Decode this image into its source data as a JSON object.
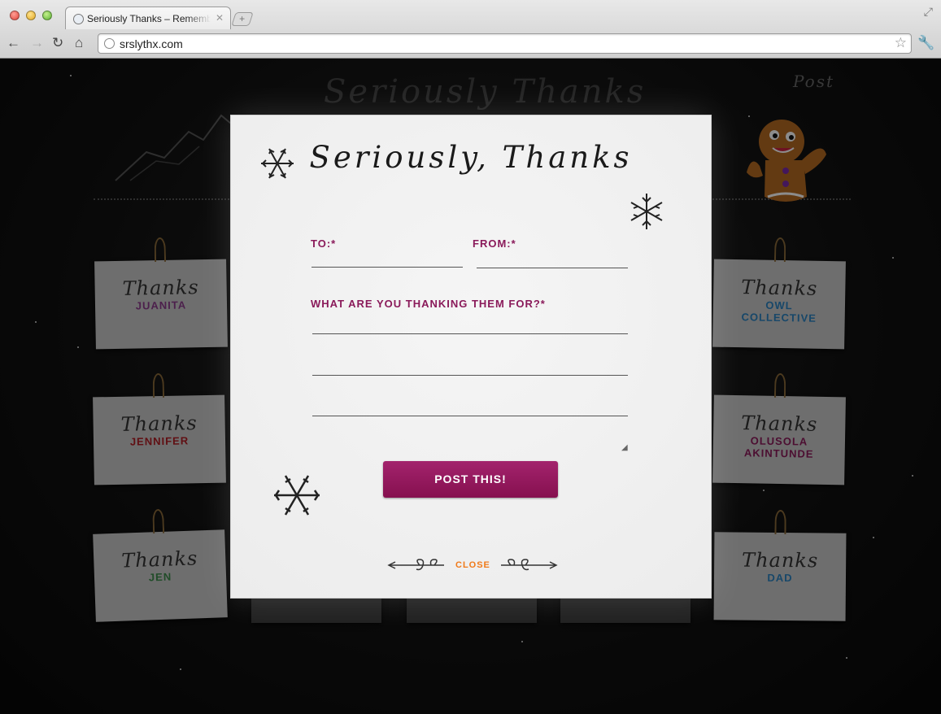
{
  "browser": {
    "tab_title": "Seriously Thanks – Remember",
    "tab_close": "✕",
    "new_tab": "+",
    "url": "srslythx.com"
  },
  "background": {
    "title": "Seriously Thanks",
    "post_label": "Post",
    "cards_left": [
      {
        "word": "Thanks",
        "name": "JUANITA",
        "name_color": "#8a3b8a"
      },
      {
        "word": "Thanks",
        "name": "JENNIFER",
        "name_color": "#b01c24"
      },
      {
        "word": "Thanks",
        "name": "JEN",
        "name_color": "#3b8a4a"
      }
    ],
    "cards_right": [
      {
        "word": "Thanks",
        "name": "OWL COLLECTIVE",
        "name_color": "#2a82c0"
      },
      {
        "word": "Thanks",
        "name": "OLUSOLA AKINTUNDE",
        "name_color": "#8a1a5a"
      },
      {
        "word": "Thanks",
        "name": "DAD",
        "name_color": "#2a82c0"
      }
    ]
  },
  "modal": {
    "title": "Seriously, Thanks",
    "to_label": "TO:*",
    "from_label": "FROM:*",
    "message_label": "WHAT ARE YOU THANKING THEM FOR?*",
    "to_value": "",
    "from_value": "",
    "message_value": "",
    "submit_label": "POST THIS!",
    "close_label": "CLOSE"
  },
  "colors": {
    "accent": "#8a1a5a",
    "button": "#96175e",
    "close_link": "#f07a19"
  }
}
